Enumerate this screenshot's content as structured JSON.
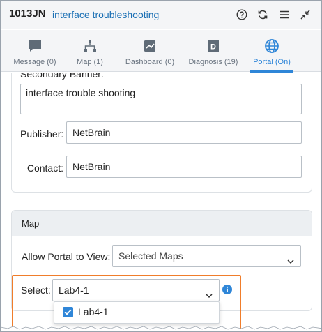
{
  "header": {
    "id": "1013JN",
    "title": "interface troubleshooting",
    "icons": [
      "help-icon",
      "refresh-icon",
      "menu-icon",
      "collapse-icon"
    ]
  },
  "tabs": [
    {
      "label": "Message (0)",
      "icon": "message-icon",
      "active": false
    },
    {
      "label": "Map (1)",
      "icon": "map-icon",
      "active": false
    },
    {
      "label": "Dashboard (0)",
      "icon": "dashboard-icon",
      "active": false
    },
    {
      "label": "Diagnosis (19)",
      "icon": "diagnosis-icon",
      "active": false
    },
    {
      "label": "Portal (On)",
      "icon": "globe-icon",
      "active": true
    }
  ],
  "portal": {
    "secondary_banner_label": "Secondary Banner:",
    "secondary_banner_value": "interface trouble shooting",
    "publisher_label": "Publisher:",
    "publisher_value": "NetBrain",
    "contact_label": "Contact:",
    "contact_value": "NetBrain"
  },
  "map_section": {
    "title": "Map",
    "allow_label": "Allow Portal to View:",
    "allow_value": "Selected Maps",
    "select_label": "Select:",
    "select_value": "Lab4-1",
    "options": [
      {
        "label": "Lab4-1",
        "checked": true
      }
    ]
  },
  "colors": {
    "accent": "#2f86d8",
    "highlight": "#f07d2b",
    "title_link": "#1a6fb4"
  }
}
